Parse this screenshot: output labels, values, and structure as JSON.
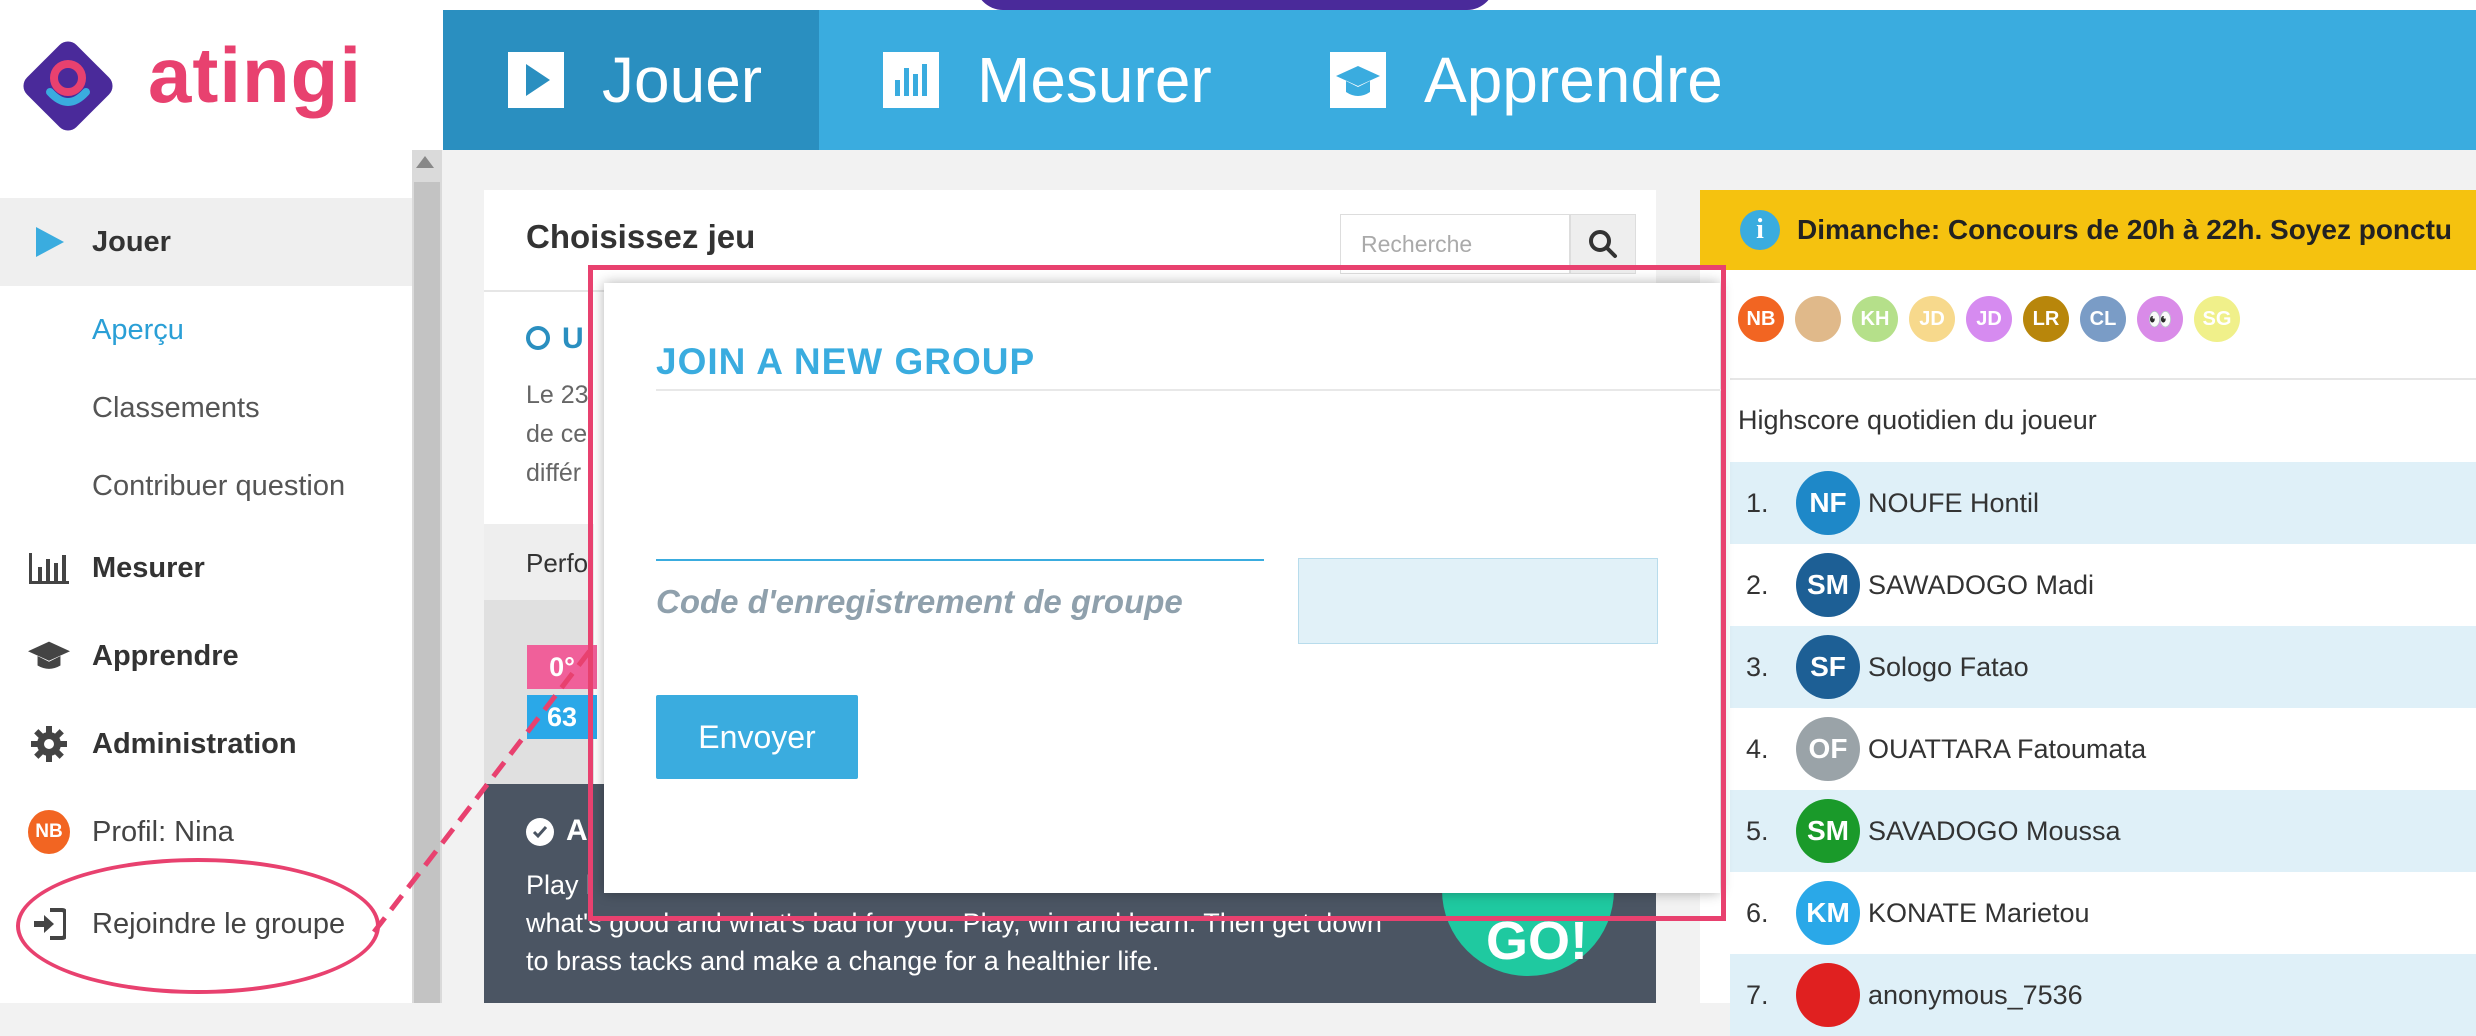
{
  "brand": {
    "name": "atingi",
    "logo_colors": [
      "#4a2a9a",
      "#e8416f",
      "#3aacdf"
    ]
  },
  "nav": {
    "tabs": [
      {
        "label": "Jouer",
        "icon": "play-icon"
      },
      {
        "label": "Mesurer",
        "icon": "bar-chart-icon"
      },
      {
        "label": "Apprendre",
        "icon": "graduation-cap-icon"
      }
    ]
  },
  "sidebar": {
    "items": [
      {
        "label": "Jouer",
        "icon": "play-icon"
      },
      {
        "label": "Aperçu"
      },
      {
        "label": "Classements"
      },
      {
        "label": "Contribuer question"
      },
      {
        "label": "Mesurer",
        "icon": "bar-chart-icon"
      },
      {
        "label": "Apprendre",
        "icon": "graduation-cap-icon"
      },
      {
        "label": "Administration",
        "icon": "gear-icon"
      },
      {
        "label": "Profil: Nina",
        "avatar": "NB"
      },
      {
        "label": "Rejoindre le groupe",
        "icon": "sign-in-icon"
      }
    ]
  },
  "game_panel": {
    "title": "Choisissez jeu",
    "search_placeholder": "Recherche",
    "partial_heading": "U",
    "partial_lines": [
      "Le 23",
      "de ce",
      "différ"
    ],
    "partial_perf": "Perfo",
    "partial_badges": [
      "0°",
      "63"
    ],
    "dark_partial_heading": "A",
    "dark_text_line1": "Play l",
    "dark_text_line2": "what's good and what's bad for you. Play, win and learn. Then get down",
    "dark_text_line3": "to brass tacks and make a change for a healthier life.",
    "go_label": "GO!"
  },
  "right_panel": {
    "banner": "Dimanche: Concours de 20h à 22h. Soyez ponctu",
    "mini_avatars": [
      {
        "initials": "NB",
        "color": "#f26522"
      },
      {
        "initials": "",
        "color": "#e0b98a"
      },
      {
        "initials": "KH",
        "color": "#b5e08a"
      },
      {
        "initials": "JD",
        "color": "#f7d98c"
      },
      {
        "initials": "JD",
        "color": "#d68bf0"
      },
      {
        "initials": "LR",
        "color": "#b8860b"
      },
      {
        "initials": "CL",
        "color": "#7a9cc6"
      },
      {
        "initials": "👀",
        "color": "#d98be8"
      },
      {
        "initials": "SG",
        "color": "#f0f08a"
      }
    ],
    "highscore_title": "Highscore quotidien du joueur",
    "rows": [
      {
        "rank": "1.",
        "initials": "NF",
        "name": "NOUFE Hontil",
        "color": "#1e88c8"
      },
      {
        "rank": "2.",
        "initials": "SM",
        "name": "SAWADOGO Madi",
        "color": "#1d5f95"
      },
      {
        "rank": "3.",
        "initials": "SF",
        "name": "Sologo Fatao",
        "color": "#1d5f95"
      },
      {
        "rank": "4.",
        "initials": "OF",
        "name": "OUATTARA Fatoumata",
        "color": "#9aa3a8"
      },
      {
        "rank": "5.",
        "initials": "SM",
        "name": "SAVADOGO Moussa",
        "color": "#1a9a2a"
      },
      {
        "rank": "6.",
        "initials": "KM",
        "name": "KONATE Marietou",
        "color": "#2aa8e8"
      },
      {
        "rank": "7.",
        "initials": "",
        "name": "anonymous_7536",
        "color": "#e02020"
      }
    ]
  },
  "modal": {
    "title": "JOIN A NEW GROUP",
    "field_label": "Code d'enregistrement de groupe",
    "input_value": "",
    "submit_label": "Envoyer"
  }
}
